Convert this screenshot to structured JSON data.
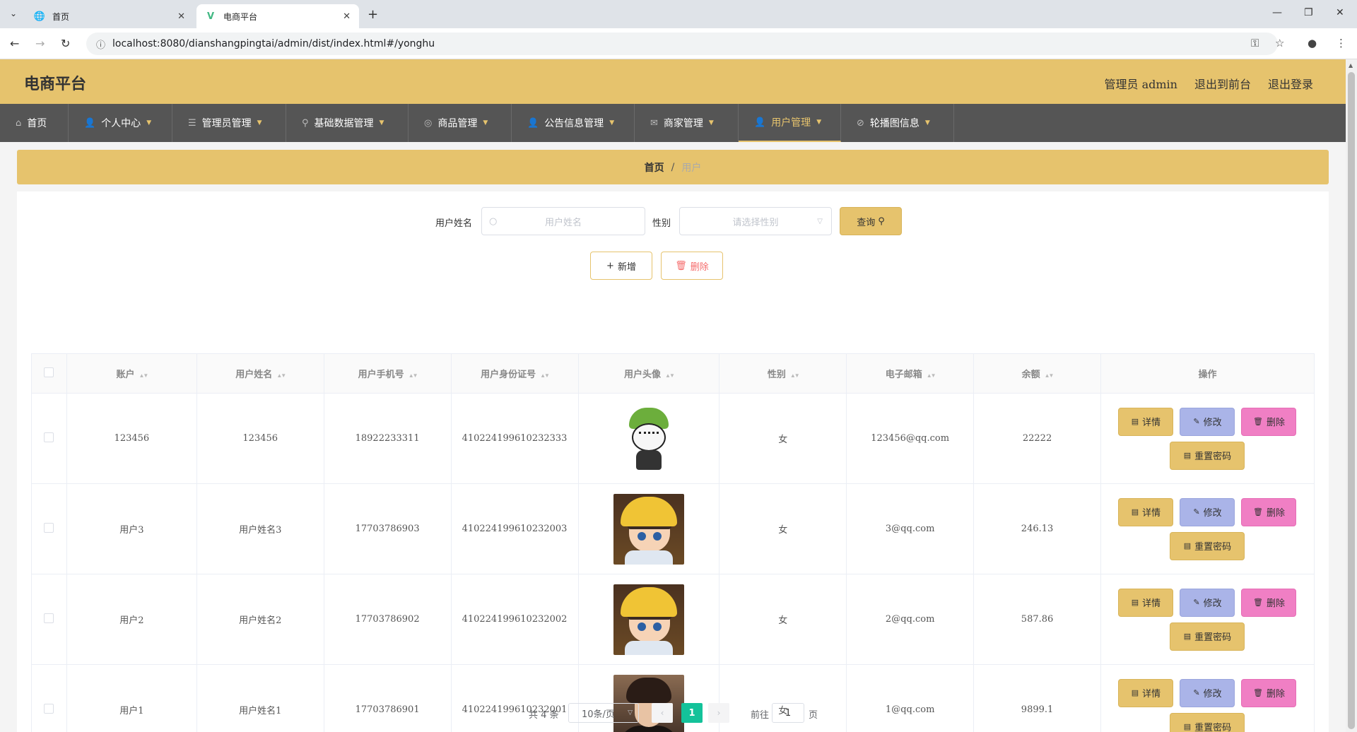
{
  "browser": {
    "tabs": [
      {
        "title": "首页",
        "icon": "globe-icon"
      },
      {
        "title": "电商平台",
        "icon": "vue-logo-icon"
      }
    ],
    "url": "localhost:8080/dianshangpingtai/admin/dist/index.html#/yonghu"
  },
  "header": {
    "brand": "电商平台",
    "user": "管理员 admin",
    "to_front": "退出到前台",
    "logout": "退出登录",
    "bg_color": "#e6c36d"
  },
  "nav": [
    {
      "label": "首页",
      "icon": "home-icon"
    },
    {
      "label": "个人中心",
      "icon": "user-icon"
    },
    {
      "label": "管理员管理",
      "icon": "list-icon"
    },
    {
      "label": "基础数据管理",
      "icon": "location-icon"
    },
    {
      "label": "商品管理",
      "icon": "globe-icon"
    },
    {
      "label": "公告信息管理",
      "icon": "user-icon"
    },
    {
      "label": "商家管理",
      "icon": "mail-icon"
    },
    {
      "label": "用户管理",
      "icon": "user-icon"
    },
    {
      "label": "轮播图信息",
      "icon": "compass-icon"
    }
  ],
  "breadcrumb": {
    "home": "首页",
    "sep": "/",
    "current": "用户"
  },
  "search": {
    "name_label": "用户姓名",
    "name_placeholder": "用户姓名",
    "gender_label": "性别",
    "gender_placeholder": "请选择性别",
    "query_label": "查询"
  },
  "actions": {
    "add_label": "新增",
    "delete_label": "删除"
  },
  "table": {
    "headers": [
      "账户",
      "用户姓名",
      "用户手机号",
      "用户身份证号",
      "用户头像",
      "性别",
      "电子邮箱",
      "余额",
      "操作"
    ],
    "rows": [
      {
        "account": "123456",
        "name": "123456",
        "phone": "18922233311",
        "idcard": "410224199610232333",
        "avatar": "cartoon-green-hat-avatar",
        "gender": "女",
        "email": "123456@qq.com",
        "balance": "22222"
      },
      {
        "account": "用户3",
        "name": "用户姓名3",
        "phone": "17703786903",
        "idcard": "410224199610232003",
        "avatar": "anime-yellow-hat-avatar",
        "gender": "女",
        "email": "3@qq.com",
        "balance": "246.13"
      },
      {
        "account": "用户2",
        "name": "用户姓名2",
        "phone": "17703786902",
        "idcard": "410224199610232002",
        "avatar": "anime-yellow-hat-avatar",
        "gender": "女",
        "email": "2@qq.com",
        "balance": "587.86"
      },
      {
        "account": "用户1",
        "name": "用户姓名1",
        "phone": "17703786901",
        "idcard": "410224199610232001",
        "avatar": "man-photo-avatar",
        "gender": "女",
        "email": "1@qq.com",
        "balance": "9899.1"
      }
    ],
    "op_labels": {
      "detail": "详情",
      "edit": "修改",
      "delete": "删除",
      "reset": "重置密码"
    }
  },
  "pagination": {
    "total": "共 4 条",
    "page_size": "10条/页",
    "current_page": "1",
    "goto_label": "前往",
    "goto_value": "1",
    "page_suffix": "页"
  }
}
